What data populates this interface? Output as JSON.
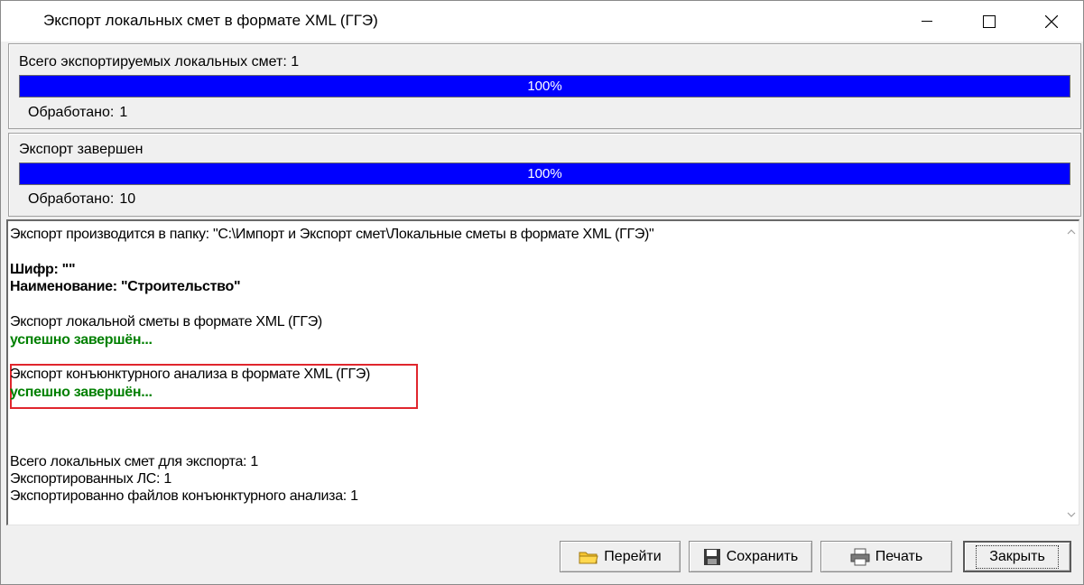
{
  "window": {
    "title": "Экспорт локальных смет в формате XML (ГГЭ)",
    "controls": [
      "minimize",
      "maximize",
      "close"
    ]
  },
  "panel1": {
    "label": "Всего экспортируемых локальных смет: 1",
    "progress_percent": 100,
    "progress_text": "100%",
    "processed_label": "Обработано:",
    "processed_value": "1"
  },
  "panel2": {
    "label": "Экспорт завершен",
    "progress_percent": 100,
    "progress_text": "100%",
    "processed_label": "Обработано:",
    "processed_value": "10"
  },
  "log": {
    "folder_line": "Экспорт производится в папку: \"C:\\Импорт и Экспорт смет\\Локальные сметы в формате XML (ГГЭ)\"",
    "cipher_line": "Шифр: \"\"",
    "name_line": "Наименование: \"Строительство\"",
    "local_export_line": "Экспорт локальной сметы в формате XML (ГГЭ)",
    "local_export_status": "успешно завершён...",
    "market_export_line": "Экспорт конъюнктурного анализа в формате XML (ГГЭ)",
    "market_export_status": "успешно завершён...",
    "total_line": "Всего локальных смет для экспорта: 1",
    "exported_line": "Экспортированных ЛС: 1",
    "market_files_line": "Экспортированно файлов конъюнктурного анализа: 1"
  },
  "buttons": {
    "goto": "Перейти",
    "save": "Сохранить",
    "print": "Печать",
    "close": "Закрыть"
  },
  "colors": {
    "progress": "#0000ff",
    "success": "#008000",
    "highlight_border": "#e0262d"
  },
  "icons": {
    "goto": "folder-icon",
    "save": "floppy-disk-icon",
    "print": "printer-icon"
  }
}
